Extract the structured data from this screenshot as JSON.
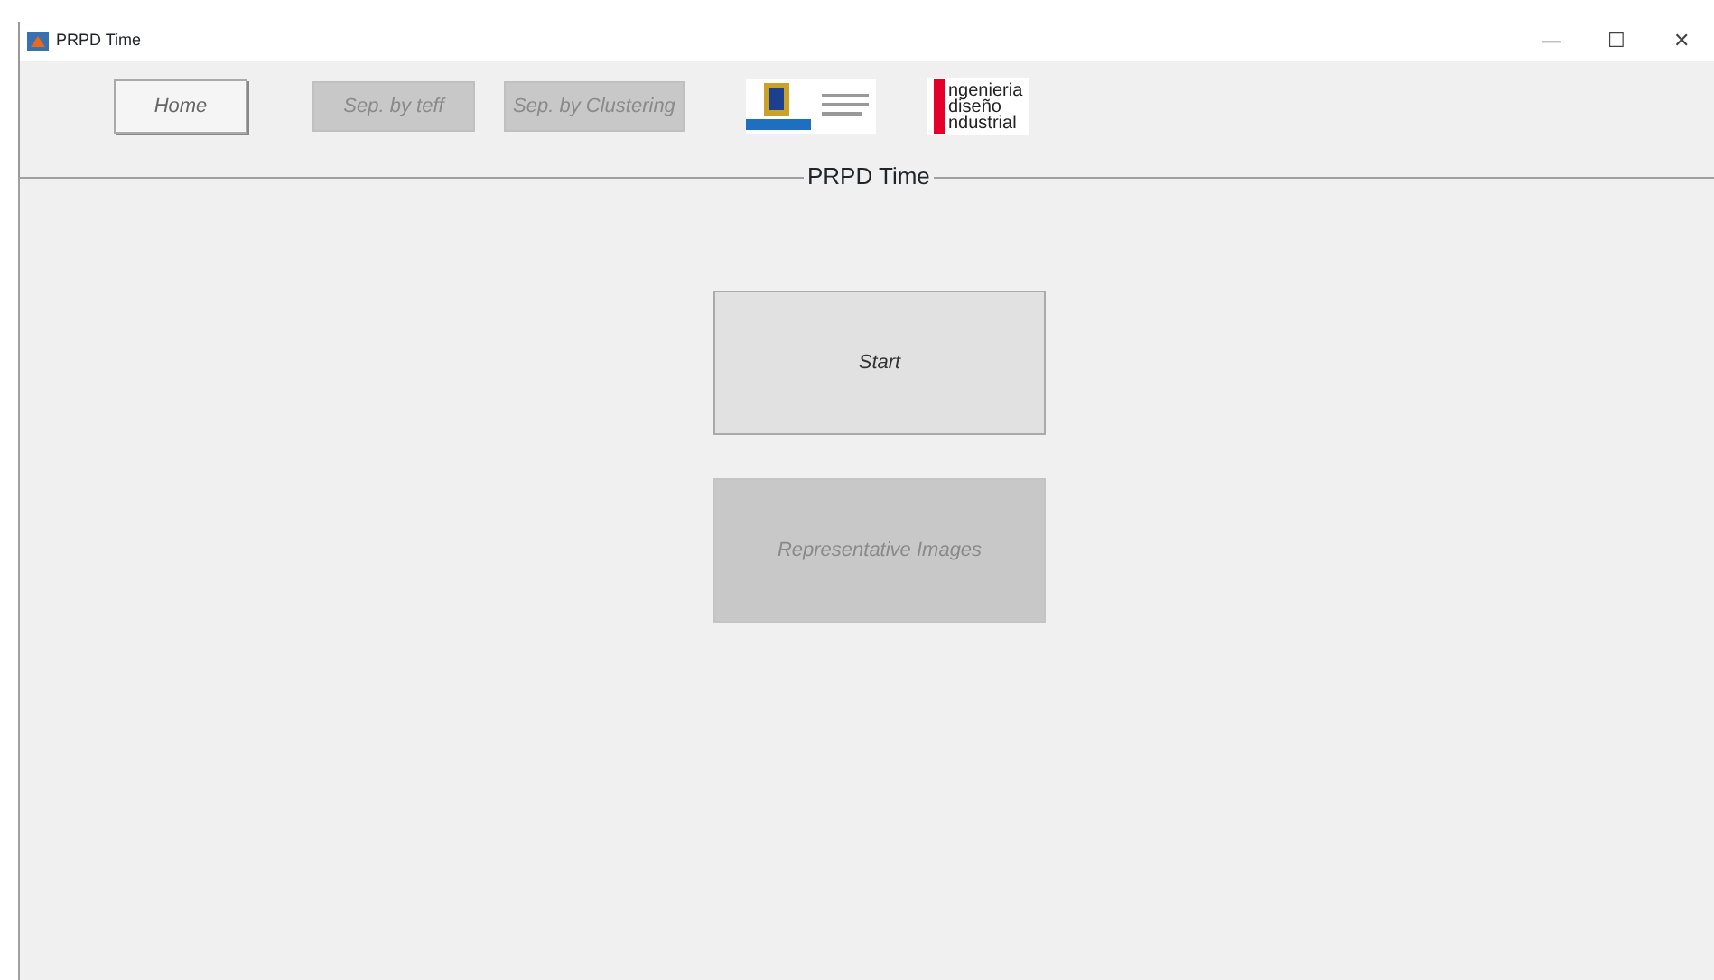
{
  "window": {
    "title": "PRPD Time",
    "controls": [
      "—",
      "☐",
      "✕"
    ]
  },
  "toolbar": [
    {
      "label": "Home",
      "disabled": false
    },
    {
      "label": "Sep. by teff",
      "disabled": true
    },
    {
      "label": "Sep. by Clustering",
      "disabled": true
    }
  ],
  "logo_text": [
    "ngenieria",
    "diseño",
    "ndustrial"
  ],
  "panel": {
    "title": "PRPD Time",
    "buttons": [
      {
        "label": "Start",
        "disabled": false
      },
      {
        "label": "Representative Images",
        "disabled": true
      }
    ]
  }
}
